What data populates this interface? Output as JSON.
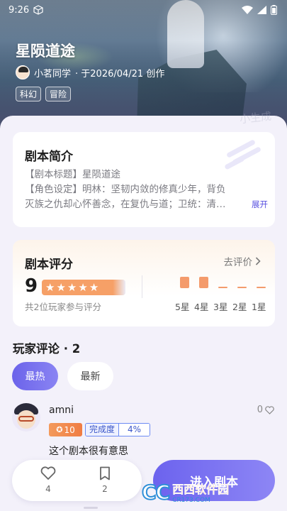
{
  "status_bar": {
    "time": "9:26"
  },
  "story": {
    "title": "星陨道途",
    "author": "小茗同学",
    "created": "· 于2026/04/21 创作",
    "tags": [
      "科幻",
      "冒险"
    ],
    "hero_watermark": "小生成"
  },
  "intro": {
    "heading": "剧本简介",
    "lines": [
      "【剧本标题】星陨道途",
      "【角色设定】明林：坚韧内敛的修真少年，背负",
      "灭族之仇却心怀善念，在复仇与道；卫统：清…"
    ],
    "expand_label": "展开"
  },
  "rating": {
    "heading": "剧本评分",
    "rate_link": "去评价",
    "score": "9",
    "stars_filled": 4.5,
    "stars_max": 5,
    "count_text": "共2位玩家参与评分",
    "distribution": [
      {
        "label": "5星",
        "value": 1
      },
      {
        "label": "4星",
        "value": 1
      },
      {
        "label": "3星",
        "value": 0
      },
      {
        "label": "2星",
        "value": 0
      },
      {
        "label": "1星",
        "value": 0
      }
    ]
  },
  "comments": {
    "heading": "玩家评论 · 2",
    "tabs": [
      "最热",
      "最新"
    ],
    "active_tab": "最热",
    "items": [
      {
        "user": "amni",
        "likes": "0",
        "level": "10",
        "progress_label": "完成度",
        "progress_value": "4%",
        "text": "这个剧本很有意思"
      }
    ]
  },
  "bottom": {
    "like_count": "4",
    "comment_count": "2",
    "enter_label": "进入剧本"
  },
  "watermark": {
    "logo": "CC",
    "name": "西西软件园",
    "url": "CR173.COM"
  },
  "colors": {
    "accent": "#6c63ee",
    "orange": "#f49b6c",
    "progress_blue": "#3c57c9"
  }
}
